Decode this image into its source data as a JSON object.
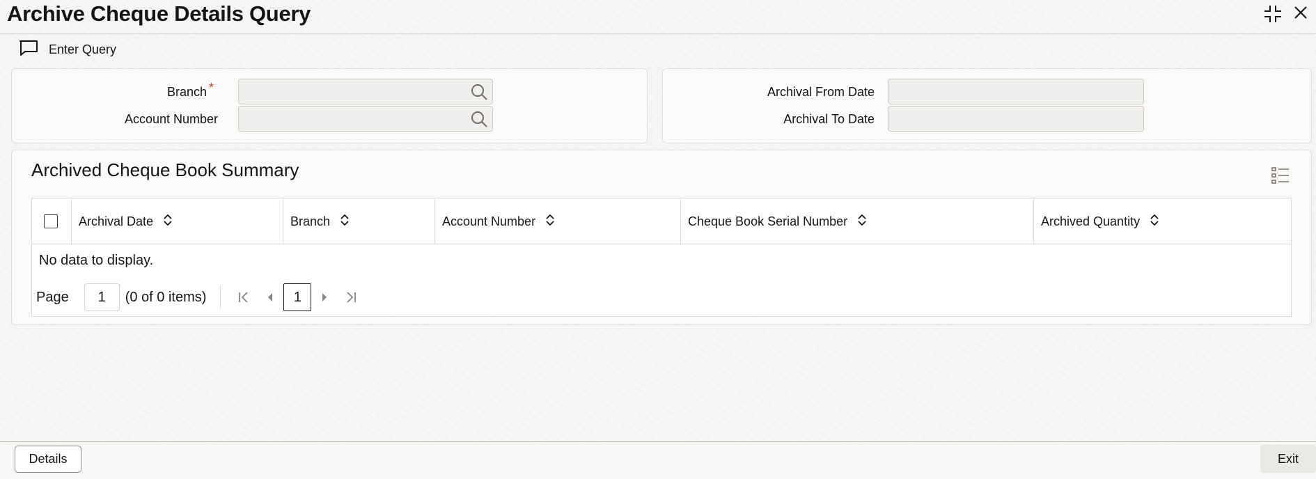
{
  "window": {
    "title": "Archive Cheque Details Query",
    "controls": [
      "compress-icon",
      "close-icon"
    ]
  },
  "toolbar": {
    "enter_query_label": "Enter Query",
    "enter_query_icon": "chat-bubble-icon"
  },
  "query_fields": {
    "branch": {
      "label": "Branch",
      "required_mark": "*",
      "value": ""
    },
    "account_number": {
      "label": "Account Number",
      "value": ""
    },
    "archival_from_date": {
      "label": "Archival From Date",
      "value": ""
    },
    "archival_to_date": {
      "label": "Archival To Date",
      "value": ""
    }
  },
  "summary": {
    "title": "Archived Cheque Book Summary",
    "columns": [
      "Archival Date",
      "Branch",
      "Account Number",
      "Cheque Book Serial Number",
      "Archived Quantity"
    ],
    "rows": [],
    "empty_message": "No data to display."
  },
  "pagination": {
    "page_label": "Page",
    "page_value": "1",
    "count_text": "(0 of 0 items)",
    "current_page": "1"
  },
  "footer": {
    "details_label": "Details",
    "exit_label": "Exit"
  },
  "colors": {
    "required": "#c74634",
    "text": "#161513",
    "border": "#dedad6",
    "input_bg": "#f1efed"
  }
}
